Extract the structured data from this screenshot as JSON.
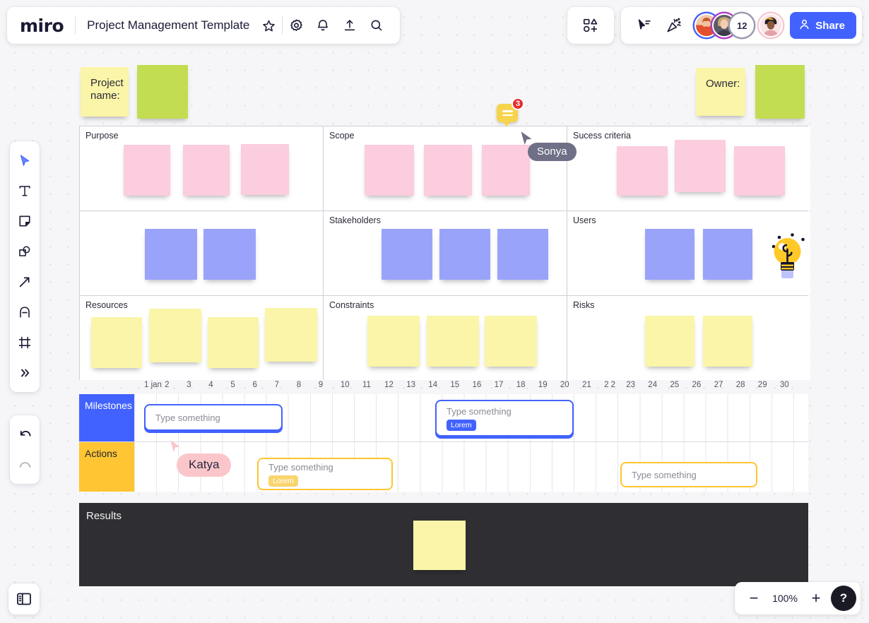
{
  "header": {
    "logo": "miro",
    "board_title": "Project Management Template",
    "icons": [
      "star-icon",
      "gear-icon",
      "bell-icon",
      "upload-icon",
      "search-icon"
    ],
    "apps_icon": "apps-grid-icon",
    "cursor_tool_icon": "cursor-select-icon",
    "celebrate_icon": "party-popper-icon",
    "avatars": [
      {
        "name": "collaborator-1",
        "ring": "#4262ff",
        "label": ""
      },
      {
        "name": "collaborator-2",
        "ring": "#b13bc4",
        "label": ""
      },
      {
        "name": "collaborator-count",
        "ring": "#9a9ab0",
        "label": "12"
      },
      {
        "name": "current-user",
        "ring": "#f7c8cf",
        "label": ""
      }
    ],
    "share_label": "Share",
    "share_color": "#4262ff"
  },
  "toolbar": {
    "tools": [
      {
        "name": "select-cursor-tool",
        "icon": "cursor-arrow-icon"
      },
      {
        "name": "text-tool",
        "icon": "text-t-icon"
      },
      {
        "name": "sticky-note-tool",
        "icon": "sticky-note-icon"
      },
      {
        "name": "shapes-tool",
        "icon": "shapes-icon"
      },
      {
        "name": "connection-line-tool",
        "icon": "arrow-diagonal-icon"
      },
      {
        "name": "pen-tool",
        "icon": "pen-draw-icon"
      },
      {
        "name": "frame-tool",
        "icon": "frame-icon"
      },
      {
        "name": "more-tools",
        "icon": "chevrons-right-icon"
      }
    ],
    "undo": "undo-arrow-icon",
    "redo": "redo-arrow-icon",
    "panel_toggle": "side-panel-icon"
  },
  "zoom": {
    "minus": "−",
    "value": "100%",
    "plus": "+",
    "help": "?"
  },
  "board": {
    "project_name_label": "Project name:",
    "owner_label": "Owner:",
    "sections": [
      {
        "title": "Purpose",
        "notes": 3,
        "color": "pink"
      },
      {
        "title": "Scope",
        "notes": 3,
        "color": "pink"
      },
      {
        "title": "Sucess criteria",
        "notes": 3,
        "color": "pink"
      },
      {
        "title": "",
        "notes": 2,
        "color": "periwinkle"
      },
      {
        "title": "Stakeholders",
        "notes": 3,
        "color": "periwinkle"
      },
      {
        "title": "Users",
        "notes": 2,
        "color": "periwinkle"
      },
      {
        "title": "Resources",
        "notes": 4,
        "color": "yellow"
      },
      {
        "title": "Constraints",
        "notes": 3,
        "color": "yellow"
      },
      {
        "title": "Risks",
        "notes": 2,
        "color": "yellow"
      }
    ],
    "results_title": "Results",
    "lightbulb_icon": "lightbulb-idea-icon"
  },
  "timeline": {
    "ruler_ticks": [
      "1 jan",
      "2",
      "3",
      "4",
      "5",
      "6",
      "7",
      "8",
      "9",
      "10",
      "11",
      "12",
      "13",
      "14",
      "15",
      "16",
      "17",
      "18",
      "19",
      "20",
      "21",
      "2 2",
      "23",
      "24",
      "25",
      "26",
      "27",
      "28",
      "29",
      "30"
    ],
    "rows": [
      {
        "label": "Milestones",
        "color": "#4262ff"
      },
      {
        "label": "Actions",
        "color": "#ffc533"
      }
    ],
    "cards": [
      {
        "row": "Milestones",
        "placeholder": "Type something",
        "tag": "",
        "accent": "#4262ff"
      },
      {
        "row": "Milestones",
        "placeholder": "Type something",
        "tag": "Lorem",
        "accent": "#4262ff"
      },
      {
        "row": "Actions",
        "placeholder": "Type something",
        "tag": "Lorem",
        "accent": "#ffc533"
      },
      {
        "row": "Actions",
        "placeholder": "Type something",
        "tag": "",
        "accent": "#ffc533"
      }
    ]
  },
  "overlays": {
    "cursor_sonya": "Sonya",
    "name_pill_katya": "Katya",
    "comment_badge_count": "3"
  }
}
